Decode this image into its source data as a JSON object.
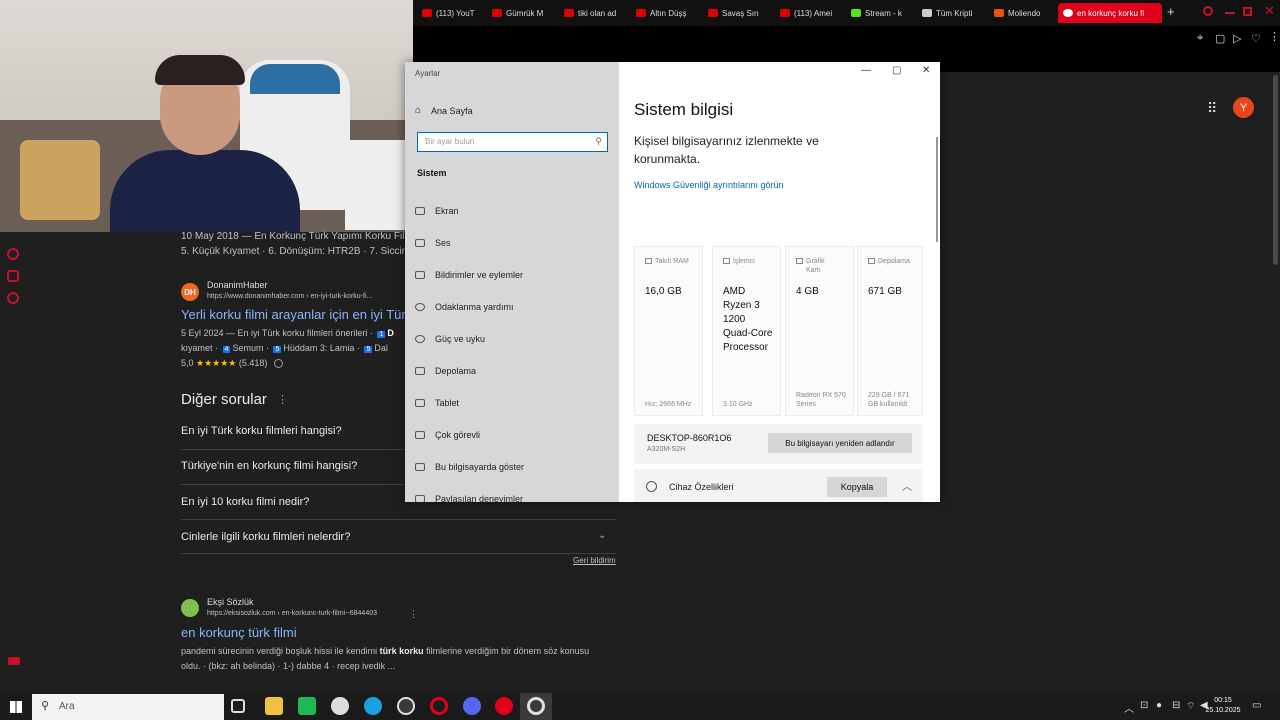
{
  "browser": {
    "tabs": [
      {
        "label": "(113) YouT",
        "fav_color": "#e00000"
      },
      {
        "label": "Gümrük M",
        "fav_color": "#e00000"
      },
      {
        "label": "tiki olan ad",
        "fav_color": "#e00000"
      },
      {
        "label": "Altın Düşş",
        "fav_color": "#e00000"
      },
      {
        "label": "Savaş Sırı",
        "fav_color": "#e00000"
      },
      {
        "label": "(113) Amei",
        "fav_color": "#e00000"
      },
      {
        "label": "Stream - k",
        "fav_color": "#55e61a"
      },
      {
        "label": "Tüm Kripti",
        "fav_color": "#cccccc"
      },
      {
        "label": "Moliendo",
        "fav_color": "#e8550c"
      },
      {
        "label": "en korkunç korku fi",
        "fav_color": "#ffffff"
      }
    ],
    "new_tab": "+",
    "account_initial": "Y"
  },
  "search": {
    "result1_snippet_line1": "10 May 2018 — En Korkunç Türk Yapımı Korku Filmle",
    "result1_snippet_line2": "5. Küçük Kıyamet · 6. Dönüşüm: HTR2B · 7. Siccin · 8",
    "result2": {
      "favicon": "DH",
      "site": "DonanimHaber",
      "url": "https://www.donanimhaber.com › en-iyi-turk-korku-fi...",
      "title": "Yerli korku filmi arayanlar için en iyi Tür",
      "snippet_line1_prefix": "5 Eyl 2024 — En iyi Türk korku filmleri önerileri ·",
      "snippet_line1_num": "1",
      "snippet_line1_end": "D",
      "snippet_line2_a": "kıyamet ·",
      "snippet_line2_num4": "4",
      "snippet_line2_b": "Semum ·",
      "snippet_line2_num5a": "5",
      "snippet_line2_c": "Hüddam 3: Lamia ·",
      "snippet_line2_num5b": "5",
      "snippet_line2_d": "Dal",
      "rating": "5,0",
      "stars": "★★★★★",
      "rating_count": "(5.418)"
    },
    "paa_title": "Diğer sorular",
    "paa_questions": [
      "En iyi Türk korku filmleri hangisi?",
      "Türkiye'nin en korkunç filmi hangisi?",
      "En iyi 10 korku filmi nedir?",
      "Cinlerle ilgili korku filmleri nelerdir?"
    ],
    "feedback": "Geri bildirim",
    "result3": {
      "site": "Ekşi Sözlük",
      "url": "https://eksisozluk.com › en-korkunc-turk-filmi--6844403",
      "title": "en korkunç türk filmi",
      "snippet_line1_a": "pandemi sürecinin verdiği boşluk hissi ile kendimi ",
      "snippet_line1_bold": "türk korku",
      "snippet_line1_b": " filmlerine verdiğim bir dönem söz konusu",
      "snippet_line2": "oldu. · (bkz: ah belinda) · 1-) dabbe 4 · recep ivedik ..."
    }
  },
  "settings": {
    "window_title": "Ayarlar",
    "home": "Ana Sayfa",
    "search_placeholder": "Bir ayar bulun",
    "section": "Sistem",
    "nav": [
      "Ekran",
      "Ses",
      "Bildirimler ve eylemler",
      "Odaklanma yardımı",
      "Güç ve uyku",
      "Depolama",
      "Tablet",
      "Çok görevli",
      "Bu bilgisayarda göster",
      "Paylaşılan deneyimler"
    ],
    "page_title": "Sistem bilgisi",
    "protection_text": "Kişisel bilgisayarınız izlenmekte ve korunmakta.",
    "security_link": "Windows Güvenliği ayrıntılarını görün",
    "cards": [
      {
        "label": "Takılı RAM",
        "value": "16,0 GB",
        "sub": "Hız: 2666 MHz"
      },
      {
        "label": "İşlemci",
        "value": "AMD Ryzen 3 1200 Quad-Core Processor",
        "sub": "3.10 GHz"
      },
      {
        "label": "Grafik Kartı",
        "value": "4 GB",
        "sub": "Radeon RX 570 Series"
      },
      {
        "label": "Depolama",
        "value": "671 GB",
        "sub": "229 GB / 671 GB kullanıldı"
      }
    ],
    "device_name": "DESKTOP-860R1O6",
    "device_model": "A320M-S2H",
    "rename_button": "Bu bilgisayarı yeniden adlandır",
    "device_specs": "Cihaz Özellikleri",
    "copy_button": "Kopyala"
  },
  "taskbar": {
    "search_placeholder": "Ara",
    "time": "00:15",
    "date": "25.10.2025"
  },
  "colors": {
    "accent_red": "#e0001b",
    "link_blue": "#8ab4f8",
    "windows_link": "#0067c0"
  }
}
